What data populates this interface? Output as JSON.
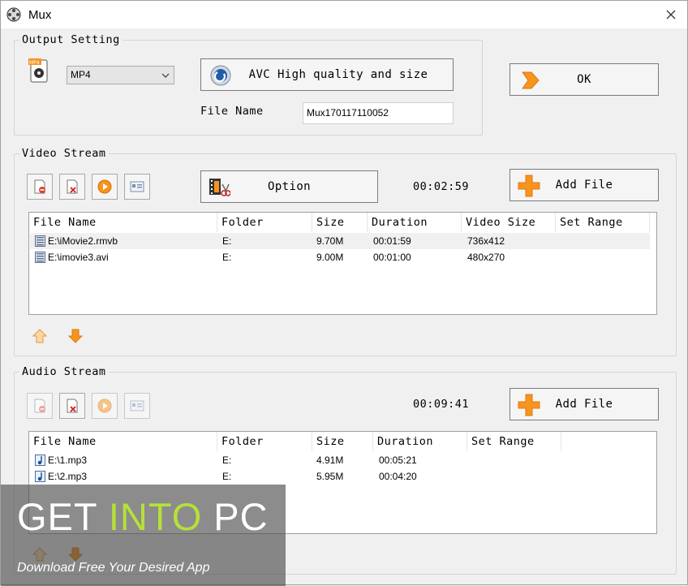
{
  "window": {
    "title": "Mux"
  },
  "output_setting": {
    "group_title": "Output Setting",
    "format_value": "MP4",
    "format_icon": "mp4-file-icon",
    "profile_label": "AVC High quality and size",
    "file_name_label": "File Name",
    "file_name_value": "Mux170117110052",
    "ok_label": "OK"
  },
  "video_stream": {
    "group_title": "Video Stream",
    "option_label": "Option",
    "duration": "00:02:59",
    "add_file_label": "Add File",
    "columns": [
      "File Name",
      "Folder",
      "Size",
      "Duration",
      "Video Size",
      "Set Range"
    ],
    "rows": [
      {
        "file": "E:\\iMovie2.rmvb",
        "folder": "E:",
        "size": "9.70M",
        "duration": "00:01:59",
        "video_size": "736x412",
        "range": ""
      },
      {
        "file": "E:\\imovie3.avi",
        "folder": "E:",
        "size": "9.00M",
        "duration": "00:01:00",
        "video_size": "480x270",
        "range": ""
      }
    ]
  },
  "audio_stream": {
    "group_title": "Audio Stream",
    "duration": "00:09:41",
    "add_file_label": "Add File",
    "columns": [
      "File Name",
      "Folder",
      "Size",
      "Duration",
      "Set Range"
    ],
    "rows": [
      {
        "file": "E:\\1.mp3",
        "folder": "E:",
        "size": "4.91M",
        "duration": "00:05:21",
        "range": ""
      },
      {
        "file": "E:\\2.mp3",
        "folder": "E:",
        "size": "5.95M",
        "duration": "00:04:20",
        "range": ""
      }
    ]
  },
  "watermark": {
    "get": "GET ",
    "into": "INTO",
    "pc": " PC",
    "subtitle": "Download Free Your Desired App"
  },
  "colors": {
    "accent_orange": "#f7941d",
    "watermark_green": "#b6e03a"
  }
}
